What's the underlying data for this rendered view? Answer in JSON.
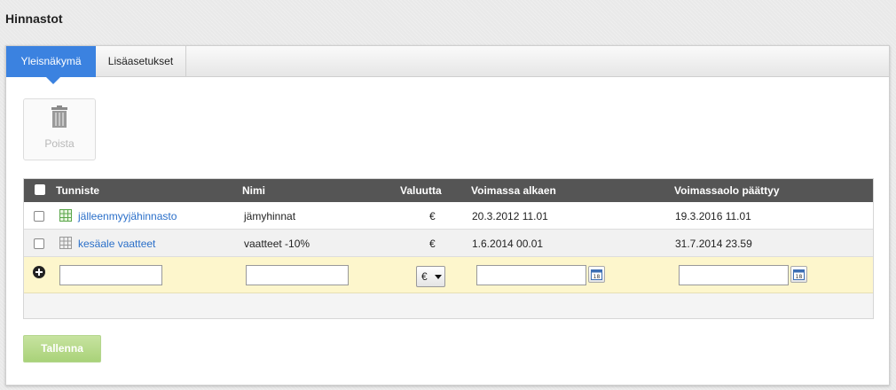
{
  "page": {
    "title": "Hinnastot"
  },
  "tabs": [
    {
      "label": "Yleisnäkymä",
      "active": true
    },
    {
      "label": "Lisäasetukset",
      "active": false
    }
  ],
  "toolbar": {
    "delete_label": "Poista",
    "delete_icon": "trash-icon"
  },
  "table": {
    "columns": [
      "Tunniste",
      "Nimi",
      "Valuutta",
      "Voimassa alkaen",
      "Voimassaolo päättyy"
    ],
    "rows": [
      {
        "id": "jälleenmyyjähinnasto",
        "name": "jämyhinnat",
        "currency": "€",
        "valid_from": "20.3.2012 11.01",
        "valid_to": "19.3.2016 11.01",
        "active": true
      },
      {
        "id": "kesäale vaatteet",
        "name": "vaatteet -10%",
        "currency": "€",
        "valid_from": "1.6.2014 00.01",
        "valid_to": "31.7.2014 23.59",
        "active": false
      }
    ],
    "new_row": {
      "id_value": "",
      "name_value": "",
      "currency_selected": "€",
      "valid_from_value": "",
      "valid_to_value": ""
    }
  },
  "actions": {
    "save_label": "Tallenna"
  },
  "colors": {
    "accent": "#3b82e0",
    "header_bg": "#555555",
    "new_row_bg": "#fdf6cc",
    "save_bg": "#b9db8c",
    "link": "#2a6fc9"
  }
}
